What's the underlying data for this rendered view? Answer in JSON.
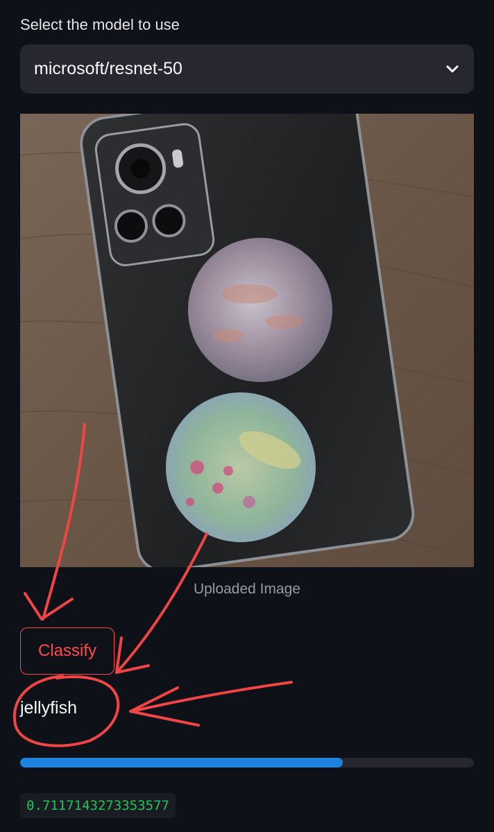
{
  "select": {
    "label": "Select the model to use",
    "value": "microsoft/resnet-50",
    "chevron_icon": "chevron-down-icon"
  },
  "image": {
    "caption": "Uploaded Image"
  },
  "classify": {
    "label": "Classify"
  },
  "result": {
    "label": "jellyfish",
    "score_fraction": 0.7117143273353577,
    "score_text": "0.7117143273353577"
  },
  "colors": {
    "background": "#0e1117",
    "accent": "#ff4b4b",
    "progress": "#1c83e1",
    "code_text": "#21c354",
    "annotation": "#f04545"
  }
}
